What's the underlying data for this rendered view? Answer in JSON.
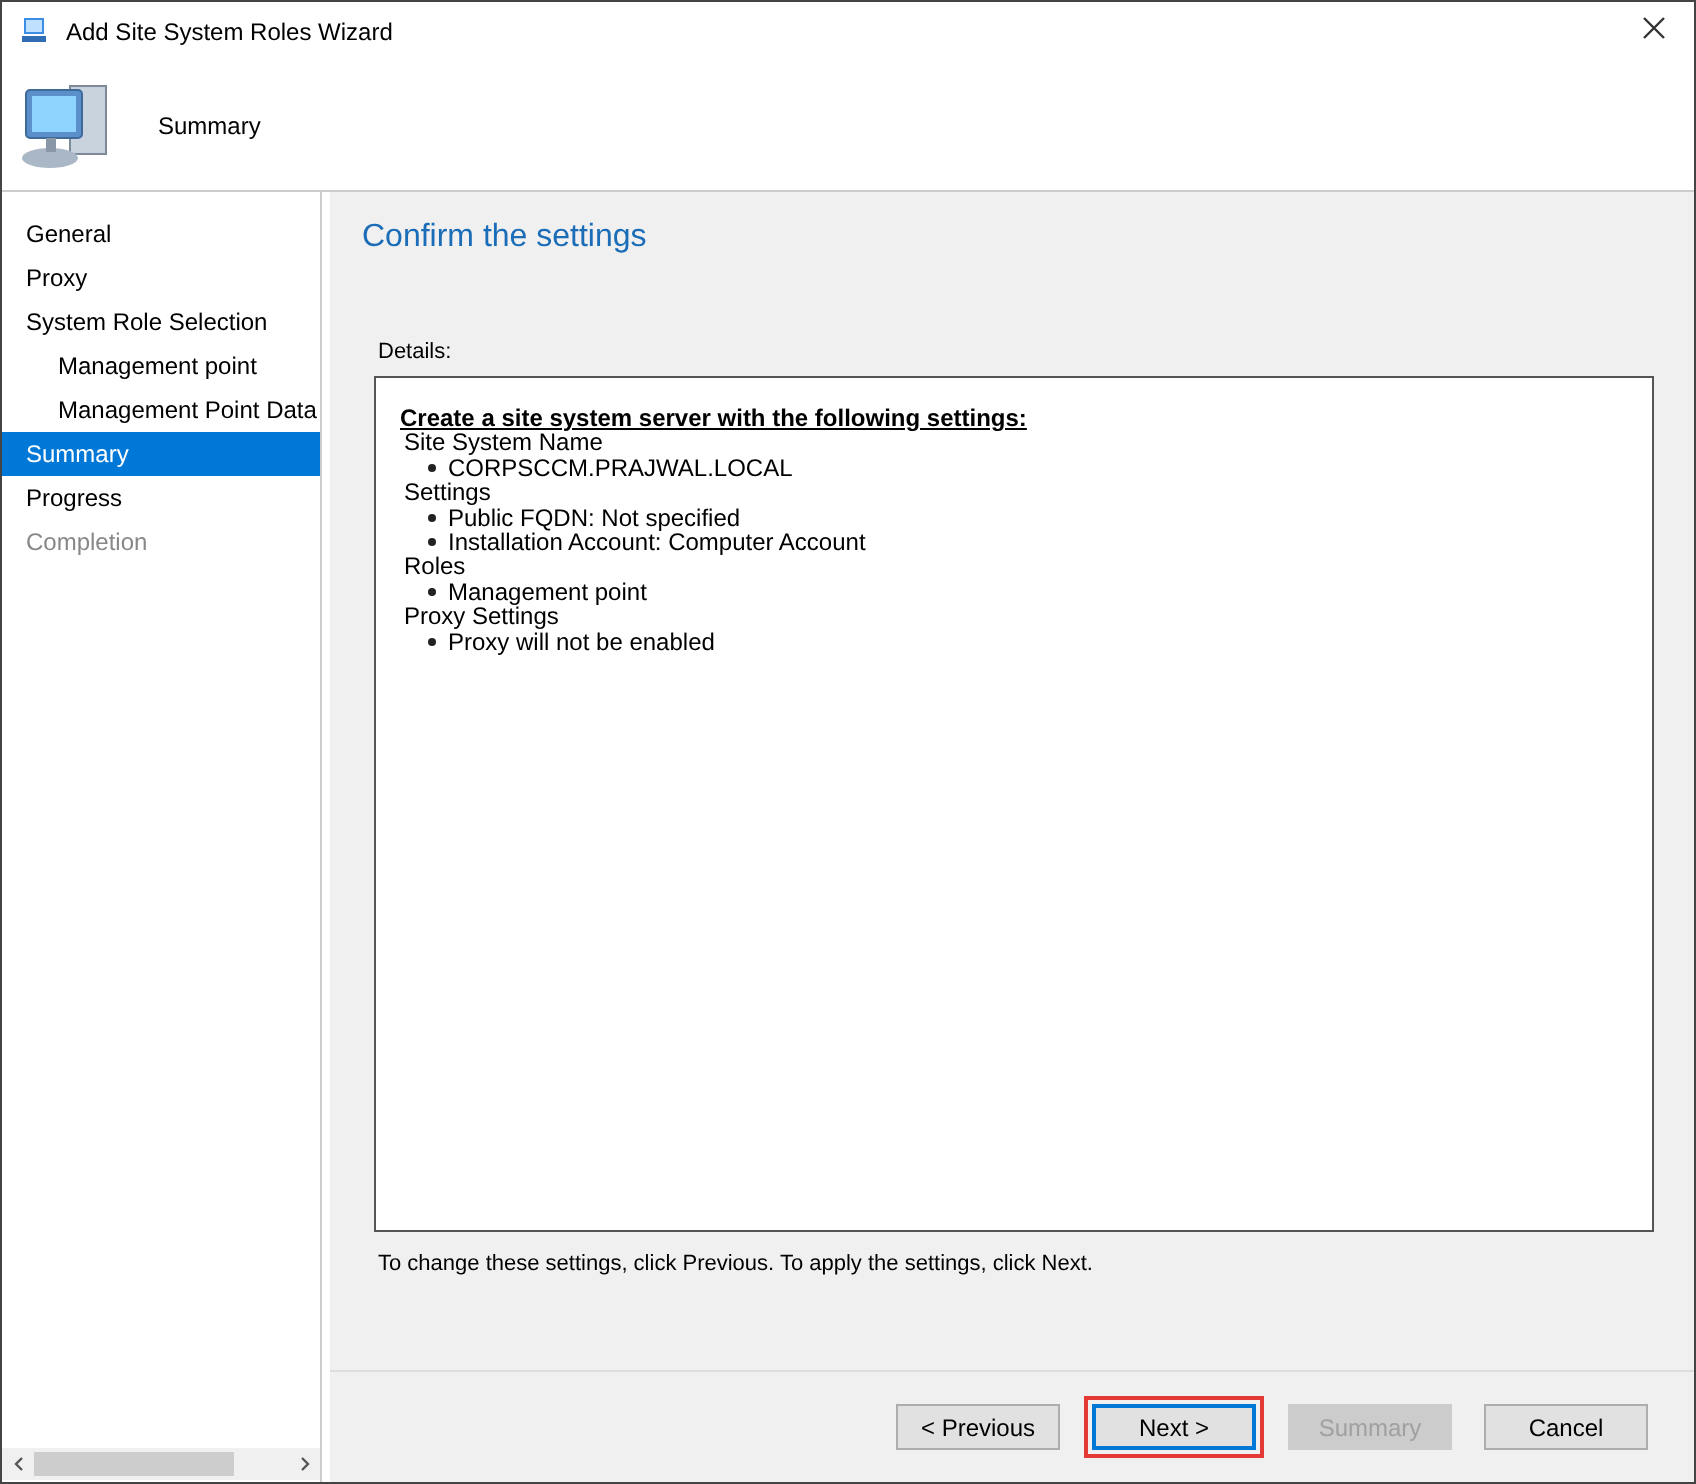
{
  "window": {
    "title": "Add Site System Roles Wizard"
  },
  "header": {
    "title": "Summary"
  },
  "sidebar": {
    "items": [
      {
        "label": "General",
        "selected": false,
        "disabled": false
      },
      {
        "label": "Proxy",
        "selected": false,
        "disabled": false
      },
      {
        "label": "System Role Selection",
        "selected": false,
        "disabled": false,
        "children": [
          {
            "label": "Management point",
            "selected": false,
            "disabled": false
          },
          {
            "label": "Management Point Data",
            "selected": false,
            "disabled": false
          }
        ]
      },
      {
        "label": "Summary",
        "selected": true,
        "disabled": false
      },
      {
        "label": "Progress",
        "selected": false,
        "disabled": false
      },
      {
        "label": "Completion",
        "selected": false,
        "disabled": true
      }
    ]
  },
  "content": {
    "heading": "Confirm the settings",
    "details_label": "Details:",
    "details": {
      "title": "Create a site system server with the following settings:",
      "sections": [
        {
          "name": "Site System Name",
          "items": [
            "CORPSCCM.PRAJWAL.LOCAL"
          ]
        },
        {
          "name": "Settings",
          "items": [
            "Public FQDN: Not specified",
            "Installation Account: Computer Account"
          ]
        },
        {
          "name": "Roles",
          "items": [
            "Management point"
          ]
        },
        {
          "name": "Proxy Settings",
          "items": [
            "Proxy will not be enabled"
          ]
        }
      ]
    },
    "hint": "To change these settings, click Previous. To apply the settings, click Next."
  },
  "buttons": [
    {
      "label": "< Previous",
      "disabled": false,
      "focused": false,
      "highlighted": false
    },
    {
      "label": "Next >",
      "disabled": false,
      "focused": true,
      "highlighted": true
    },
    {
      "label": "Summary",
      "disabled": true,
      "focused": false,
      "highlighted": false
    },
    {
      "label": "Cancel",
      "disabled": false,
      "focused": false,
      "highlighted": false
    }
  ]
}
